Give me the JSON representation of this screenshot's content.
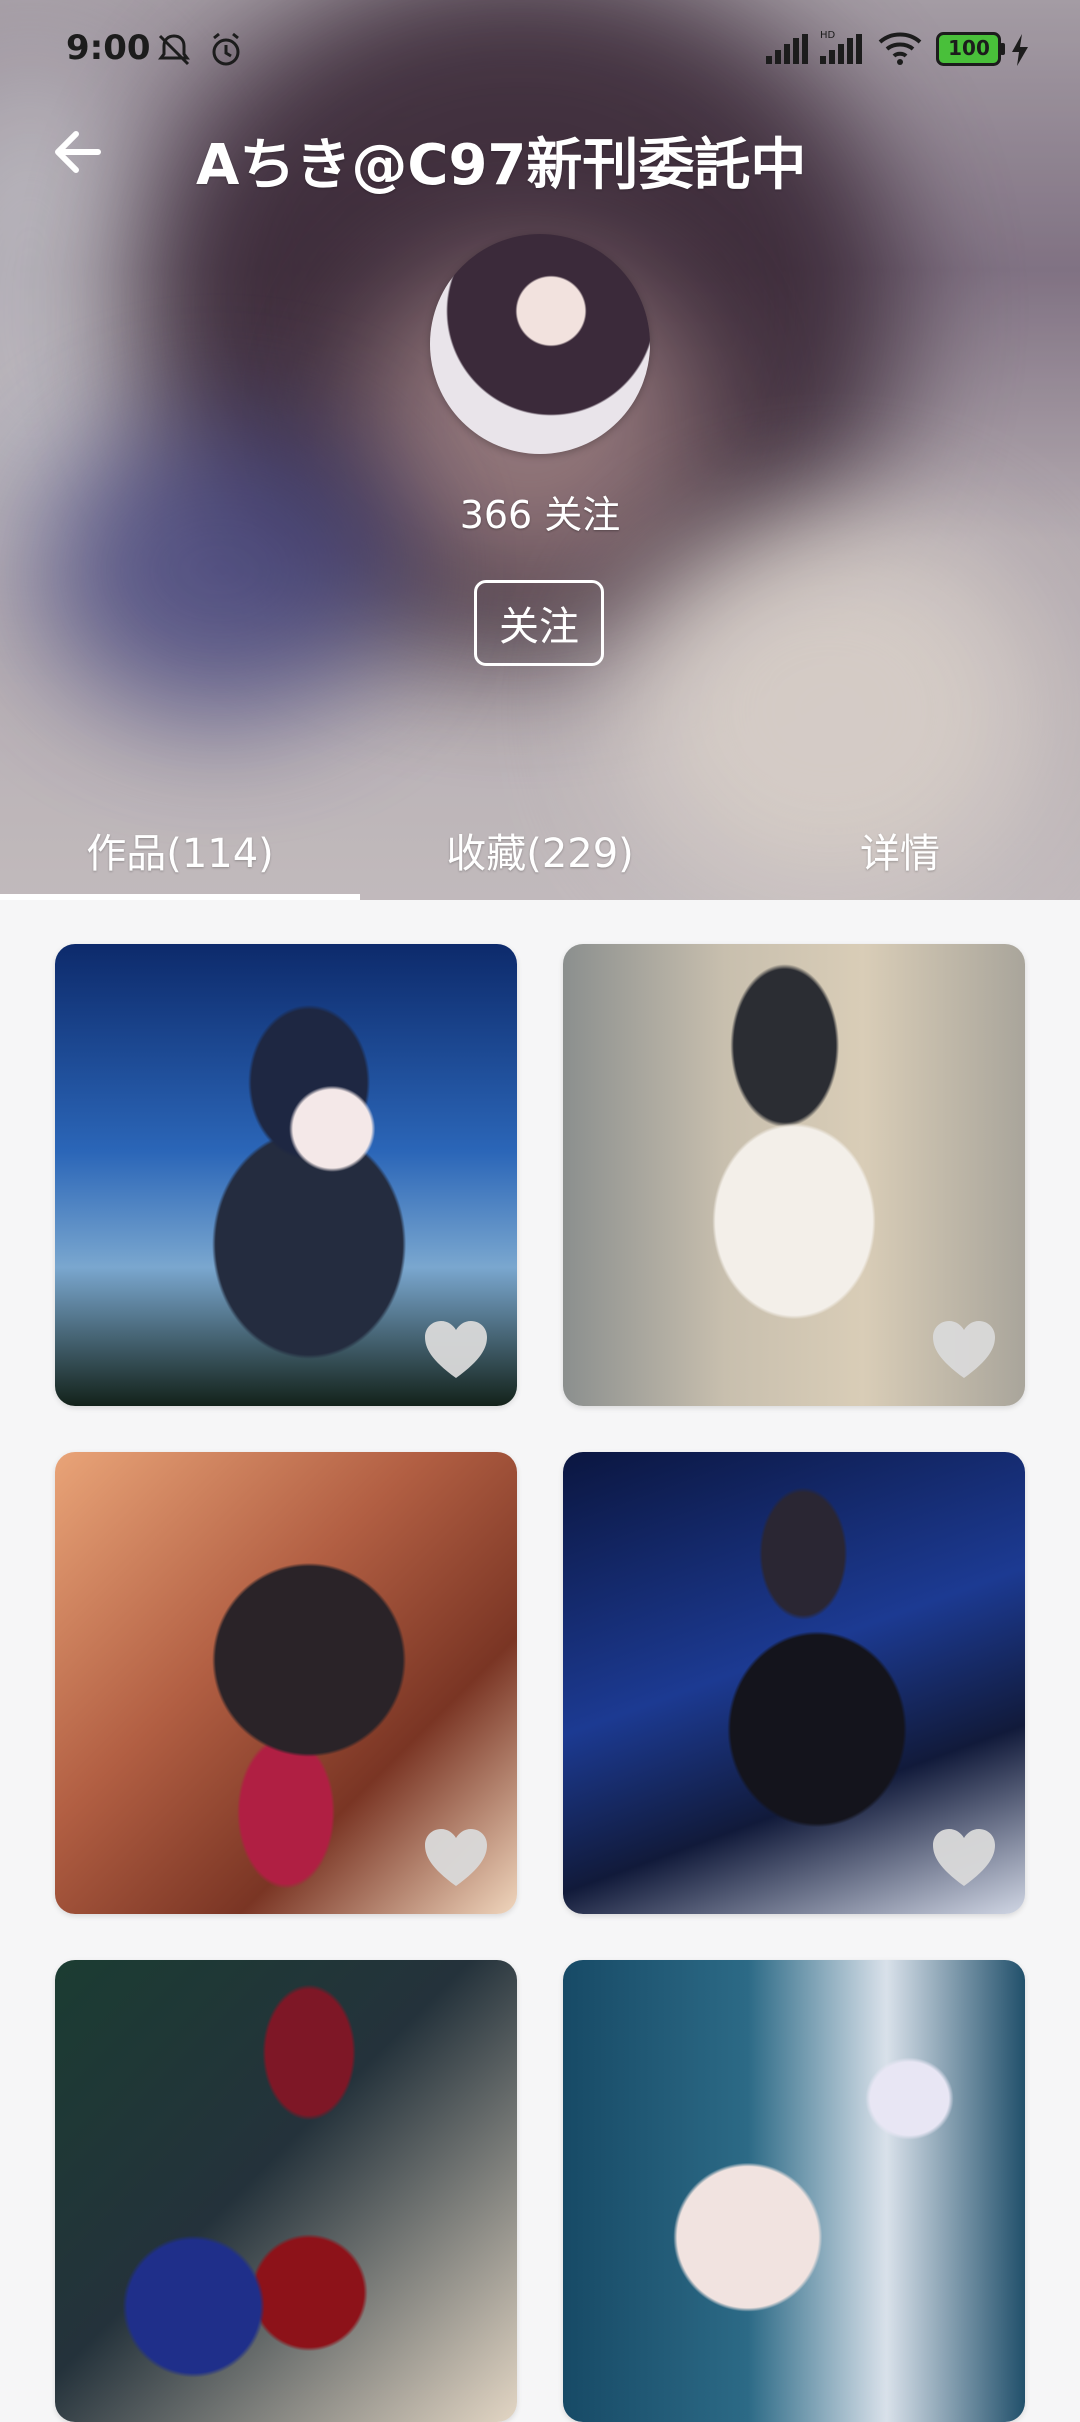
{
  "status_bar": {
    "time": "9:00",
    "battery": "100",
    "icons": [
      "dnd-off-icon",
      "alarm-icon",
      "signal-icon",
      "hd-signal-icon",
      "wifi-icon",
      "battery-icon",
      "charging-icon"
    ]
  },
  "header": {
    "back_icon": "arrow-left-icon",
    "title": "Aちき@C97新刊委託中",
    "follow_count": "366 关注",
    "follow_button": "关注"
  },
  "tabs": [
    {
      "label": "作品(114)",
      "active": true
    },
    {
      "label": "收藏(229)",
      "active": false
    },
    {
      "label": "详情",
      "active": false
    }
  ],
  "works": [
    {
      "id": 1,
      "liked": false,
      "icon": "heart-icon"
    },
    {
      "id": 2,
      "liked": false,
      "icon": "heart-icon"
    },
    {
      "id": 3,
      "liked": false,
      "icon": "heart-icon"
    },
    {
      "id": 4,
      "liked": false,
      "icon": "heart-icon"
    },
    {
      "id": 5,
      "liked": false,
      "icon": "heart-icon"
    },
    {
      "id": 6,
      "liked": false,
      "icon": "heart-icon"
    }
  ],
  "colors": {
    "accent": "#ffffff",
    "heart": "#d9d9d9",
    "background": "#f6f6f7"
  }
}
